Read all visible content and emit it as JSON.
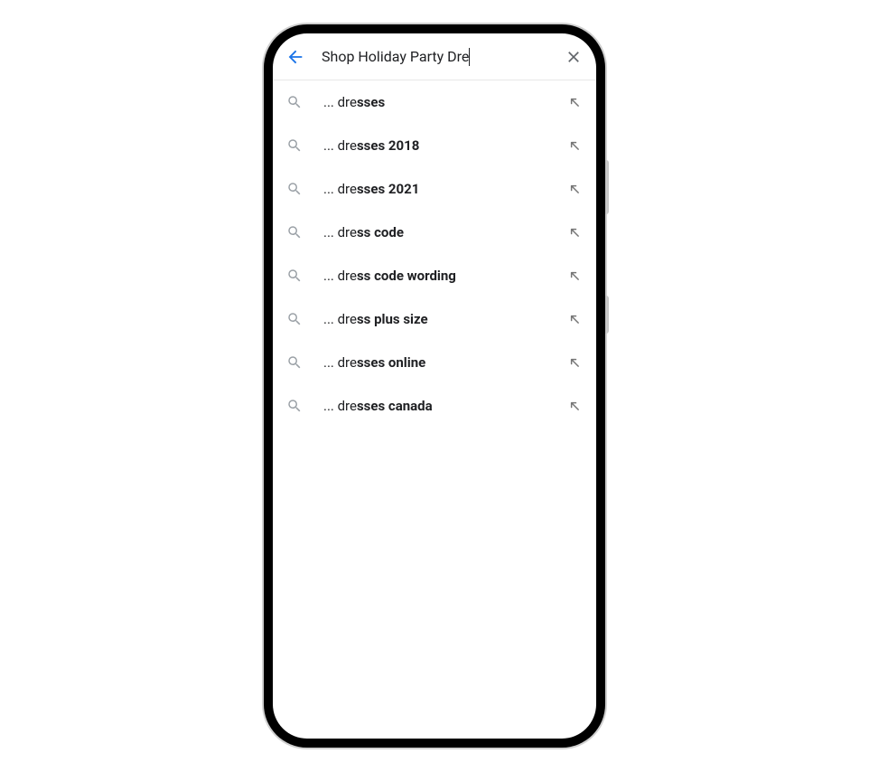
{
  "search": {
    "value": "Shop Holiday Party Dre"
  },
  "suggestion_prefix": "... ",
  "suggestions": [
    {
      "typed": "dre",
      "completion": "sses"
    },
    {
      "typed": "dre",
      "completion": "sses 2018"
    },
    {
      "typed": "dre",
      "completion": "sses 2021"
    },
    {
      "typed": "dre",
      "completion": "ss code"
    },
    {
      "typed": "dre",
      "completion": "ss code wording"
    },
    {
      "typed": "dre",
      "completion": "ss plus size"
    },
    {
      "typed": "dre",
      "completion": "sses online"
    },
    {
      "typed": "dre",
      "completion": "sses canada"
    }
  ],
  "icons": {
    "back": "back-arrow-icon",
    "clear": "close-icon",
    "search": "search-icon",
    "insert": "arrow-up-left-icon"
  },
  "colors": {
    "back_arrow": "#1a73e8",
    "icon_gray": "#757575",
    "text": "#202124",
    "divider": "#e8e8e8"
  }
}
